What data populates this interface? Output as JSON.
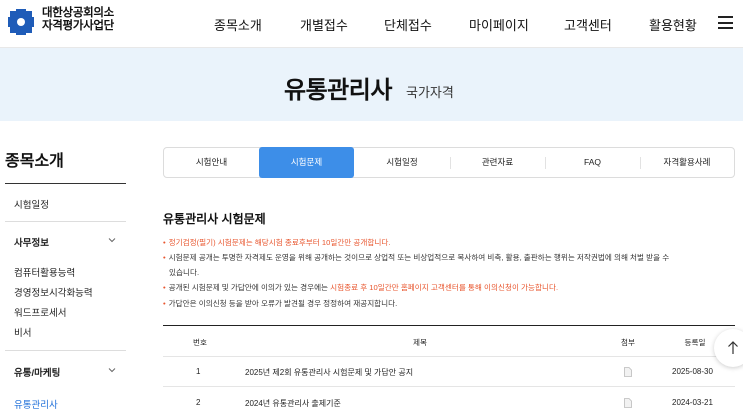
{
  "org": {
    "name_line1": "대한상공회의소",
    "name_line2": "자격평가사업단"
  },
  "nav": [
    "종목소개",
    "개별접수",
    "단체접수",
    "마이페이지",
    "고객센터",
    "활용현황"
  ],
  "banner": {
    "title": "유통관리사",
    "subtitle": "국가자격"
  },
  "sidebar": {
    "title": "종목소개",
    "items": [
      {
        "label": "시험일정"
      },
      {
        "label": "사무정보"
      },
      {
        "label": "컴퓨터활용능력"
      },
      {
        "label": "경영정보시각화능력"
      },
      {
        "label": "워드프로세서"
      },
      {
        "label": "비서"
      },
      {
        "label": "유통/마케팅"
      },
      {
        "label": "유통관리사"
      }
    ]
  },
  "tabs": [
    "시험안내",
    "시험문제",
    "시험일정",
    "관련자료",
    "FAQ",
    "자격활용사례"
  ],
  "section": {
    "title": "유통관리사 시험문제",
    "notices": [
      {
        "text": "정기검정(필기) 시험문제는 해당시험 종료후부터 10일간만 공개합니다."
      },
      {
        "line1": "시험문제 공개는 투명한 자격제도 운영을 위해 공개하는 것이므로 상업적 또는 비상업적으로 복사하여 비축, 활용, 출판하는 행위는 저작권법에 의해 처벌 받을 수",
        "line2": "있습니다."
      },
      {
        "before": "공개된 시험문제 및 가답안에 이의가 있는 경우에는 ",
        "highlight": "시험종료 후 10일간만 홈페이지 고객센터를 통해 이의신청이 가능합니다."
      },
      {
        "text": "가답안은 이의신청 등을 받아 오류가 발견될 경우 정정하여 재공지합니다."
      }
    ]
  },
  "table": {
    "headers": [
      "번호",
      "제목",
      "첨부",
      "등록일"
    ],
    "rows": [
      {
        "no": "1",
        "title": "2025년 제2회 유통관리사 시험문제 및 가답안 공지",
        "date": "2025-08-30"
      },
      {
        "no": "2",
        "title": "2024년 유통관리사 출제기준",
        "date": "2024-03-21"
      }
    ]
  },
  "colors": {
    "accent": "#3d8ee8",
    "highlight": "#e8552d",
    "banner_bg": "#eaf3fb",
    "logo_blue": "#1f5cb8"
  }
}
